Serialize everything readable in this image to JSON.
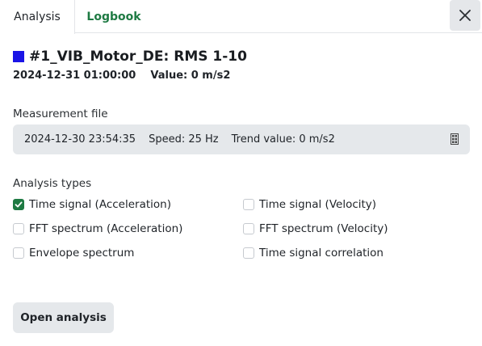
{
  "tabs": [
    {
      "label": "Analysis",
      "active": true
    },
    {
      "label": "Logbook",
      "active": false
    }
  ],
  "header": {
    "color": "#1a14e6",
    "title": "#1_VIB_Motor_DE: RMS 1-10",
    "datetime": "2024-12-31 01:00:00",
    "value": "Value: 0 m/s2"
  },
  "measurement_file": {
    "label": "Measurement file",
    "datetime": "2024-12-30 23:54:35",
    "speed": "Speed: 25 Hz",
    "trend": "Trend value: 0 m/s2",
    "icon": "qr-code-icon"
  },
  "analysis_types": {
    "label": "Analysis types",
    "items": [
      {
        "label": "Time signal (Acceleration)",
        "checked": true
      },
      {
        "label": "Time signal (Velocity)",
        "checked": false
      },
      {
        "label": "FFT spectrum (Acceleration)",
        "checked": false
      },
      {
        "label": "FFT spectrum (Velocity)",
        "checked": false
      },
      {
        "label": "Envelope spectrum",
        "checked": false
      },
      {
        "label": "Time signal correlation",
        "checked": false
      }
    ]
  },
  "actions": {
    "open_analysis": "Open analysis"
  },
  "colors": {
    "accent": "#1e7a43",
    "button_bg": "#e5e8eb"
  }
}
